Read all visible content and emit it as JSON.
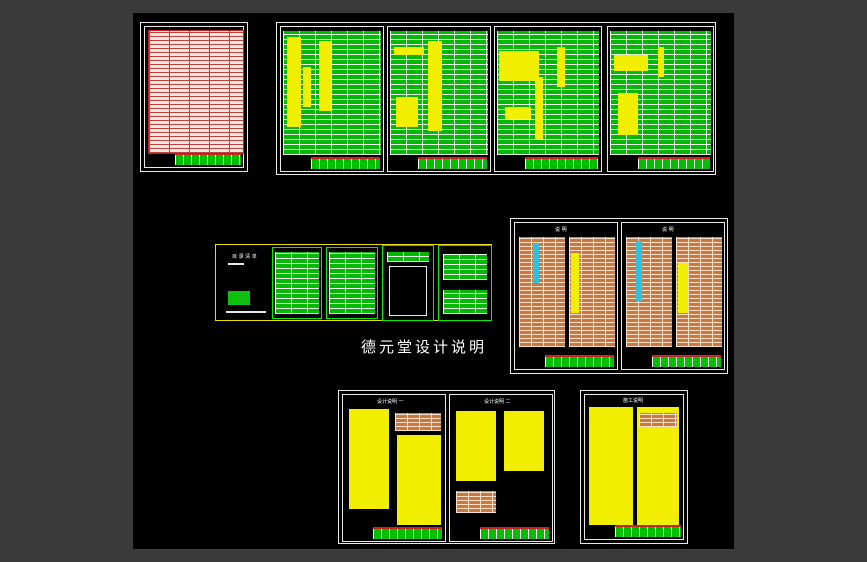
{
  "canvas_label": "德元堂设计说明",
  "sheet_heads": {
    "catalog": "目 录 清 单",
    "orange_left": "说 明",
    "orange_right": "说 明",
    "yellow_a": "设计说明 一",
    "yellow_b": "设计说明 二",
    "yellow_c": "施工说明"
  },
  "colors": {
    "background": "#000000",
    "frame": "#e8e8e8",
    "table_green": "#06b806",
    "text_yellow": "#f2ee00",
    "table_orange": "#c87840"
  }
}
